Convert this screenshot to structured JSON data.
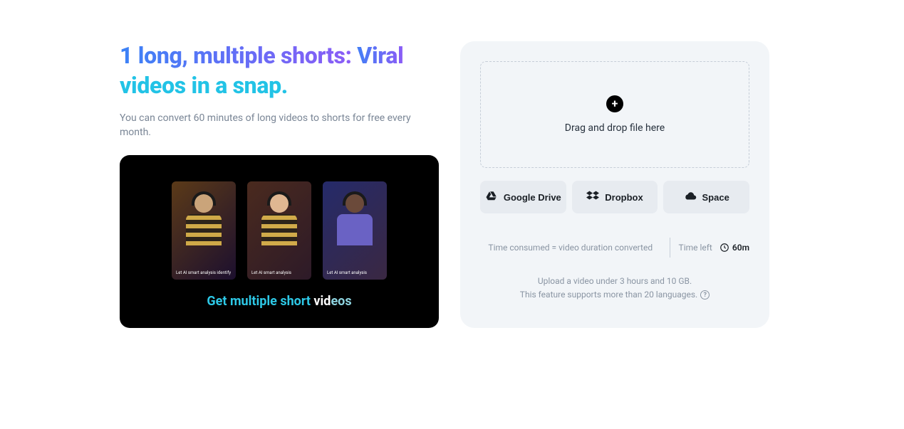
{
  "left": {
    "headline_part1": "1 long, multiple shorts:",
    "headline_part2_a": " Viral",
    "headline_part2_b": "videos in a snap.",
    "subtext": "You can convert 60 minutes of long videos to shorts for free every month.",
    "preview": {
      "short_captions": [
        "Let AI smart analysis identify",
        "Let AI smart analysis",
        "Let AI smart analysis"
      ],
      "caption_p1": "Get multiple short ",
      "caption_p2": "vid",
      "caption_p3": "eos"
    }
  },
  "right": {
    "dropzone_text": "Drag and drop file here",
    "sources": {
      "google_drive": "Google Drive",
      "dropbox": "Dropbox",
      "space": "Space"
    },
    "info": {
      "consumed_text": "Time consumed = video duration converted",
      "time_left_label": "Time left",
      "time_left_value": "60m"
    },
    "limits": {
      "line1": "Upload a video under 3 hours and 10 GB.",
      "line2": "This feature supports more than 20 languages."
    }
  }
}
